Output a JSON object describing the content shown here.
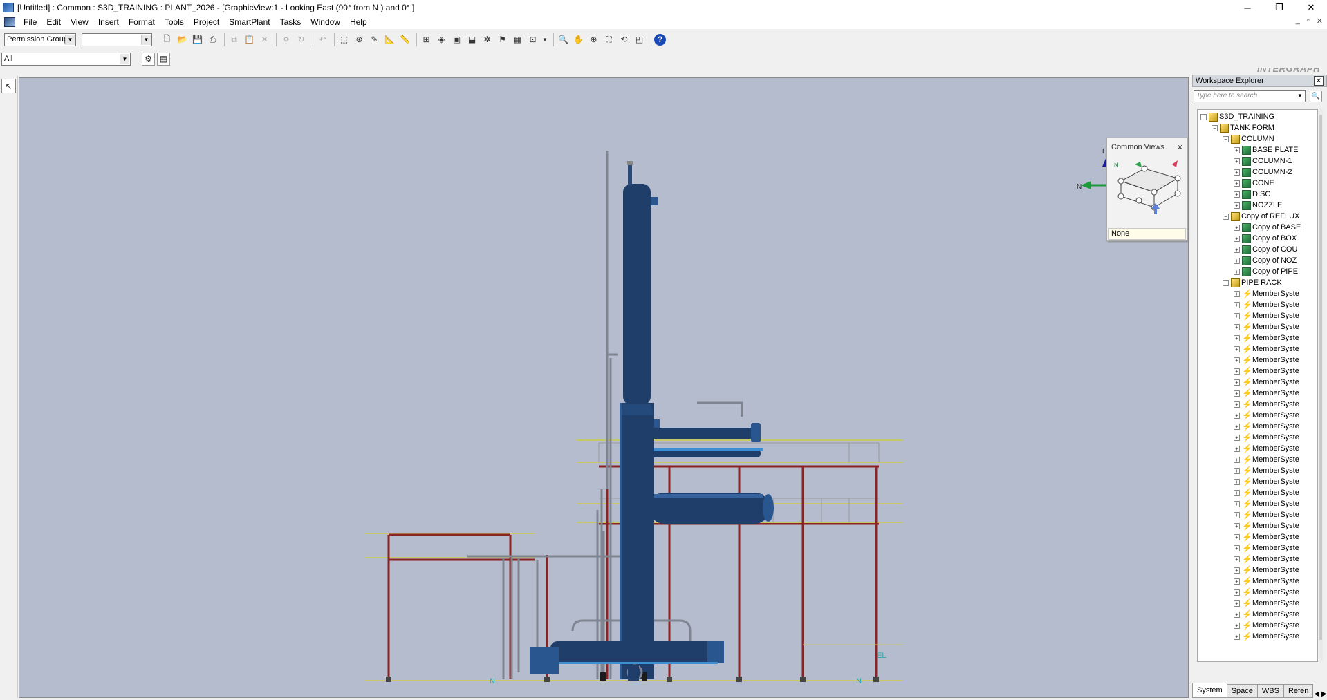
{
  "titlebar": {
    "title": "[Untitled] : Common : S3D_TRAINING : PLANT_2026 - [GraphicView:1 - Looking East (90° from N ) and 0° ]",
    "minimize": "─",
    "restore": "❐",
    "close": "✕"
  },
  "menubar": {
    "items": [
      "File",
      "Edit",
      "View",
      "Insert",
      "Format",
      "Tools",
      "Project",
      "SmartPlant",
      "Tasks",
      "Window",
      "Help"
    ],
    "mdi_min": "_",
    "mdi_restore": "▫",
    "mdi_close": "✕"
  },
  "toolbar": {
    "permission_group": "Permission Group",
    "second_combo": "",
    "filter": "All",
    "brand": "INTERGRAPH"
  },
  "common_views": {
    "title": "Common Views",
    "north_label": "N",
    "selection": "None"
  },
  "viewport": {
    "compass_el": "El",
    "compass_n": "N",
    "marker_n1": "N",
    "marker_n2": "N",
    "marker_el": "EL",
    "colors": {
      "background": "#b4bccd",
      "equipment": "#1f3e6a",
      "steel": "#8b2323",
      "platform": "#c6c86a",
      "pipe": "#7f8590"
    }
  },
  "explorer": {
    "title": "Workspace Explorer",
    "close": "✕",
    "search_placeholder": "Type here to search",
    "tree": [
      {
        "label": "S3D_TRAINING",
        "level": 0,
        "exp": "−",
        "icon": "sys"
      },
      {
        "label": "TANK FORM",
        "level": 1,
        "exp": "−",
        "icon": "sys"
      },
      {
        "label": "COLUMN",
        "level": 2,
        "exp": "−",
        "icon": "sys"
      },
      {
        "label": "BASE PLATE",
        "level": 3,
        "exp": "+",
        "icon": "eq"
      },
      {
        "label": "COLUMN-1",
        "level": 3,
        "exp": "+",
        "icon": "eq"
      },
      {
        "label": "COLUMN-2",
        "level": 3,
        "exp": "+",
        "icon": "eq"
      },
      {
        "label": "CONE",
        "level": 3,
        "exp": "+",
        "icon": "eq"
      },
      {
        "label": "DISC",
        "level": 3,
        "exp": "+",
        "icon": "eq"
      },
      {
        "label": "NOZZLE",
        "level": 3,
        "exp": "+",
        "icon": "eq"
      },
      {
        "label": "Copy of REFLUX",
        "level": 2,
        "exp": "−",
        "icon": "sys"
      },
      {
        "label": "Copy of BASE",
        "level": 3,
        "exp": "+",
        "icon": "eq"
      },
      {
        "label": "Copy of BOX",
        "level": 3,
        "exp": "+",
        "icon": "eq"
      },
      {
        "label": "Copy of COU",
        "level": 3,
        "exp": "+",
        "icon": "eq"
      },
      {
        "label": "Copy of NOZ",
        "level": 3,
        "exp": "+",
        "icon": "eq"
      },
      {
        "label": "Copy of PIPE",
        "level": 3,
        "exp": "+",
        "icon": "eq"
      },
      {
        "label": "PIPE RACK",
        "level": 2,
        "exp": "−",
        "icon": "sys"
      },
      {
        "label": "MemberSyste",
        "level": 3,
        "exp": "+",
        "icon": "mem"
      },
      {
        "label": "MemberSyste",
        "level": 3,
        "exp": "+",
        "icon": "mem"
      },
      {
        "label": "MemberSyste",
        "level": 3,
        "exp": "+",
        "icon": "mem"
      },
      {
        "label": "MemberSyste",
        "level": 3,
        "exp": "+",
        "icon": "mem"
      },
      {
        "label": "MemberSyste",
        "level": 3,
        "exp": "+",
        "icon": "mem"
      },
      {
        "label": "MemberSyste",
        "level": 3,
        "exp": "+",
        "icon": "mem"
      },
      {
        "label": "MemberSyste",
        "level": 3,
        "exp": "+",
        "icon": "mem"
      },
      {
        "label": "MemberSyste",
        "level": 3,
        "exp": "+",
        "icon": "mem"
      },
      {
        "label": "MemberSyste",
        "level": 3,
        "exp": "+",
        "icon": "mem"
      },
      {
        "label": "MemberSyste",
        "level": 3,
        "exp": "+",
        "icon": "mem"
      },
      {
        "label": "MemberSyste",
        "level": 3,
        "exp": "+",
        "icon": "mem"
      },
      {
        "label": "MemberSyste",
        "level": 3,
        "exp": "+",
        "icon": "mem"
      },
      {
        "label": "MemberSyste",
        "level": 3,
        "exp": "+",
        "icon": "mem"
      },
      {
        "label": "MemberSyste",
        "level": 3,
        "exp": "+",
        "icon": "mem"
      },
      {
        "label": "MemberSyste",
        "level": 3,
        "exp": "+",
        "icon": "mem"
      },
      {
        "label": "MemberSyste",
        "level": 3,
        "exp": "+",
        "icon": "mem"
      },
      {
        "label": "MemberSyste",
        "level": 3,
        "exp": "+",
        "icon": "mem"
      },
      {
        "label": "MemberSyste",
        "level": 3,
        "exp": "+",
        "icon": "mem"
      },
      {
        "label": "MemberSyste",
        "level": 3,
        "exp": "+",
        "icon": "mem"
      },
      {
        "label": "MemberSyste",
        "level": 3,
        "exp": "+",
        "icon": "mem"
      },
      {
        "label": "MemberSyste",
        "level": 3,
        "exp": "+",
        "icon": "mem"
      },
      {
        "label": "MemberSyste",
        "level": 3,
        "exp": "+",
        "icon": "mem"
      },
      {
        "label": "MemberSyste",
        "level": 3,
        "exp": "+",
        "icon": "mem"
      },
      {
        "label": "MemberSyste",
        "level": 3,
        "exp": "+",
        "icon": "mem"
      },
      {
        "label": "MemberSyste",
        "level": 3,
        "exp": "+",
        "icon": "mem"
      },
      {
        "label": "MemberSyste",
        "level": 3,
        "exp": "+",
        "icon": "mem"
      },
      {
        "label": "MemberSyste",
        "level": 3,
        "exp": "+",
        "icon": "mem"
      },
      {
        "label": "MemberSyste",
        "level": 3,
        "exp": "+",
        "icon": "mem"
      },
      {
        "label": "MemberSyste",
        "level": 3,
        "exp": "+",
        "icon": "mem"
      },
      {
        "label": "MemberSyste",
        "level": 3,
        "exp": "+",
        "icon": "mem"
      },
      {
        "label": "MemberSyste",
        "level": 3,
        "exp": "+",
        "icon": "mem"
      },
      {
        "label": "MemberSyste",
        "level": 3,
        "exp": "+",
        "icon": "mem"
      }
    ],
    "tabs": [
      "System",
      "Space",
      "WBS",
      "Refen"
    ]
  }
}
